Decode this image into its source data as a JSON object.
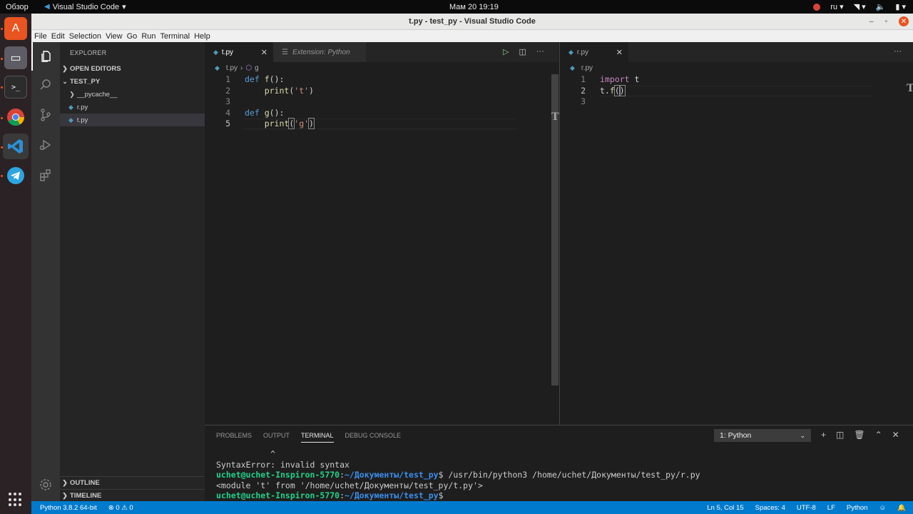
{
  "topbar": {
    "activities": "Обзор",
    "app_name": "Visual Studio Code",
    "app_caret": "▾",
    "clock": "Мам 20  19:19",
    "lang": "ru",
    "lang_caret": "▾",
    "wifi": "▾",
    "volume": "🔈",
    "battery": "▮",
    "power_caret": "▾"
  },
  "window": {
    "title": "t.py - test_py - Visual Studio Code",
    "minimize": "–",
    "maximize": "▫",
    "close": "✕"
  },
  "menubar": [
    "File",
    "Edit",
    "Selection",
    "View",
    "Go",
    "Run",
    "Terminal",
    "Help"
  ],
  "sidebar": {
    "title": "EXPLORER",
    "open_editors": "OPEN EDITORS",
    "folder": "TEST_PY",
    "items": [
      {
        "label": "__pycache__",
        "type": "folder"
      },
      {
        "label": "r.py",
        "type": "py"
      },
      {
        "label": "t.py",
        "type": "py"
      }
    ],
    "outline": "OUTLINE",
    "timeline": "TIMELINE"
  },
  "editor1": {
    "tab_active": "t.py",
    "tab_inactive": "Extension: Python",
    "breadcrumb_file": "t.py",
    "breadcrumb_symbol": "g",
    "lines": [
      {
        "n": "1",
        "code": [
          {
            "t": "def ",
            "c": "kw"
          },
          {
            "t": "f",
            "c": "fn"
          },
          {
            "t": "():",
            "c": ""
          }
        ]
      },
      {
        "n": "2",
        "code": [
          {
            "t": "    ",
            "c": ""
          },
          {
            "t": "print",
            "c": "fn"
          },
          {
            "t": "(",
            "c": ""
          },
          {
            "t": "'t'",
            "c": "str"
          },
          {
            "t": ")",
            "c": ""
          }
        ]
      },
      {
        "n": "3",
        "code": []
      },
      {
        "n": "4",
        "code": [
          {
            "t": "def ",
            "c": "kw"
          },
          {
            "t": "g",
            "c": "fn"
          },
          {
            "t": "():",
            "c": ""
          }
        ]
      },
      {
        "n": "5",
        "code": [
          {
            "t": "    ",
            "c": ""
          },
          {
            "t": "print",
            "c": "fn"
          },
          {
            "t": "(",
            "c": "bracket"
          },
          {
            "t": "'g'",
            "c": "str"
          },
          {
            "t": ")",
            "c": "bracket"
          }
        ]
      }
    ]
  },
  "editor2": {
    "tab_active": "r.py",
    "breadcrumb_file": "r.py",
    "lines": [
      {
        "n": "1",
        "code": [
          {
            "t": "import",
            "c": "kw2"
          },
          {
            "t": " t",
            "c": ""
          }
        ]
      },
      {
        "n": "2",
        "code": [
          {
            "t": "t.",
            "c": ""
          },
          {
            "t": "f",
            "c": "fn"
          },
          {
            "t": "(",
            "c": "bracket"
          },
          {
            "t": ")",
            "c": "bracket"
          }
        ]
      },
      {
        "n": "3",
        "code": []
      }
    ]
  },
  "panel": {
    "tabs": [
      "PROBLEMS",
      "OUTPUT",
      "TERMINAL",
      "DEBUG CONSOLE"
    ],
    "active_tab": "TERMINAL",
    "terminal_select": "1: Python",
    "terminal_lines": [
      {
        "parts": [
          {
            "t": "           ^",
            "c": ""
          }
        ]
      },
      {
        "parts": [
          {
            "t": "SyntaxError: invalid syntax",
            "c": ""
          }
        ]
      },
      {
        "parts": [
          {
            "t": "uchet@uchet-Inspiron-5770",
            "c": "tuser"
          },
          {
            "t": ":",
            "c": ""
          },
          {
            "t": "~/Документы/test_py",
            "c": "tpath"
          },
          {
            "t": "$ /usr/bin/python3 /home/uchet/Документы/test_py/r.py",
            "c": ""
          }
        ]
      },
      {
        "parts": [
          {
            "t": "<module 't' from '/home/uchet/Документы/test_py/t.py'>",
            "c": ""
          }
        ]
      },
      {
        "parts": [
          {
            "t": "uchet@uchet-Inspiron-5770",
            "c": "tuser"
          },
          {
            "t": ":",
            "c": ""
          },
          {
            "t": "~/Документы/test_py",
            "c": "tpath"
          },
          {
            "t": "$ ",
            "c": ""
          }
        ]
      }
    ]
  },
  "statusbar": {
    "python": "Python 3.8.2 64-bit",
    "problems": "⊗ 0 ⚠ 0",
    "position": "Ln 5, Col 15",
    "spaces": "Spaces: 4",
    "encoding": "UTF-8",
    "eol": "LF",
    "language": "Python"
  }
}
